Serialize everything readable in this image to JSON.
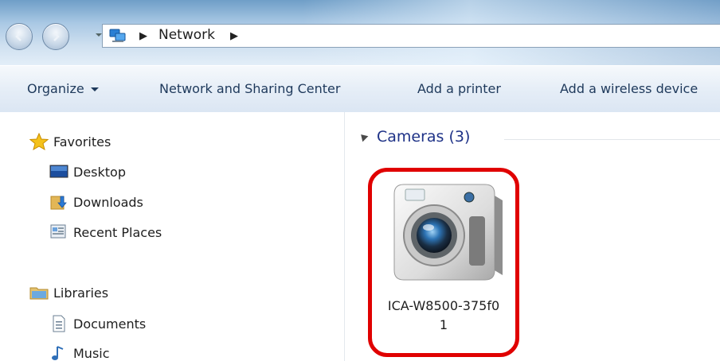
{
  "window": {
    "breadcrumb": [
      "Network"
    ],
    "back_icon": "back-arrow-icon",
    "forward_icon": "forward-arrow-icon"
  },
  "toolbar": {
    "organize": "Organize",
    "network_sharing": "Network and Sharing Center",
    "add_printer": "Add a printer",
    "add_wireless": "Add a wireless device"
  },
  "sidebar": {
    "favorites": {
      "label": "Favorites",
      "icon": "star-icon"
    },
    "favorite_items": [
      {
        "label": "Desktop",
        "icon": "desktop-icon"
      },
      {
        "label": "Downloads",
        "icon": "downloads-icon"
      },
      {
        "label": "Recent Places",
        "icon": "recent-places-icon"
      }
    ],
    "libraries": {
      "label": "Libraries",
      "icon": "libraries-icon"
    },
    "library_items": [
      {
        "label": "Documents",
        "icon": "documents-icon"
      },
      {
        "label": "Music",
        "icon": "music-icon"
      }
    ]
  },
  "content": {
    "group": {
      "label": "Cameras (3)"
    },
    "devices": [
      {
        "name_line1": "ICA-W8500-375f0",
        "name_line2": "1",
        "icon": "camera-icon",
        "highlight_color": "#e00000"
      }
    ]
  },
  "colors": {
    "accent_text": "#1e3287",
    "highlight": "#e00000",
    "command_text": "#1e395b"
  }
}
